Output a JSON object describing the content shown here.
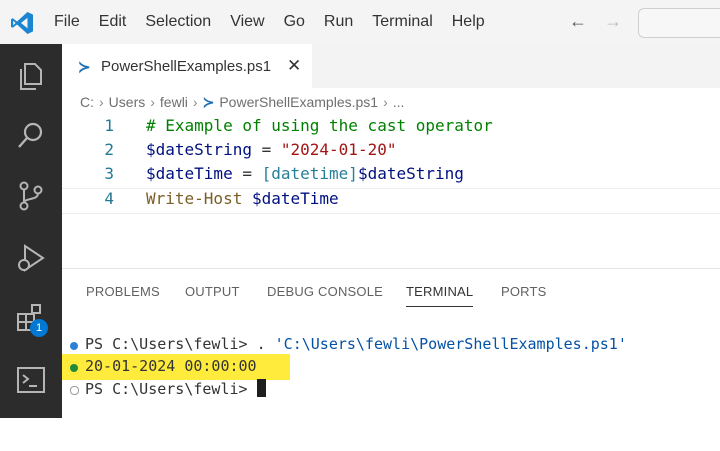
{
  "menu": {
    "items": [
      "File",
      "Edit",
      "Selection",
      "View",
      "Go",
      "Run",
      "Terminal",
      "Help"
    ]
  },
  "tab": {
    "filename": "PowerShellExamples.ps1",
    "close": "✕",
    "icon_glyph": "≻"
  },
  "breadcrumb": {
    "parts": [
      "C:",
      "Users",
      "fewli",
      "PowerShellExamples.ps1",
      "..."
    ]
  },
  "editor": {
    "line_numbers": [
      "1",
      "2",
      "3",
      "4"
    ],
    "lines": [
      [
        {
          "t": "# Example of using the cast operator",
          "c": "com"
        }
      ],
      [
        {
          "t": "$dateString",
          "c": "var"
        },
        {
          "t": " = ",
          "c": "op"
        },
        {
          "t": "\"2024-01-20\"",
          "c": "str"
        }
      ],
      [
        {
          "t": "$dateTime",
          "c": "var"
        },
        {
          "t": " = ",
          "c": "op"
        },
        {
          "t": "[datetime]",
          "c": "type"
        },
        {
          "t": "$dateString",
          "c": "var"
        }
      ],
      [
        {
          "t": "Write-Host",
          "c": "cmd"
        },
        {
          "t": " ",
          "c": "op"
        },
        {
          "t": "$dateTime",
          "c": "var"
        }
      ]
    ]
  },
  "panel": {
    "tabs": [
      "PROBLEMS",
      "OUTPUT",
      "DEBUG CONSOLE",
      "TERMINAL",
      "PORTS"
    ],
    "active_tab": "TERMINAL"
  },
  "terminal": {
    "line1_prompt": "PS C:\\Users\\fewli> ",
    "line1_cmd": ". ",
    "line1_path": "'C:\\Users\\fewli\\PowerShellExamples.ps1'",
    "line2_output": "20-01-2024 00:00:00",
    "line3_prompt": "PS C:\\Users\\fewli> "
  },
  "activity": {
    "badge_count": "1"
  },
  "colors": {
    "accent": "#0078d4",
    "highlight": "#ffeb3b",
    "dot_blue": "#2f7fd6",
    "dot_green": "#1f8a3a"
  }
}
